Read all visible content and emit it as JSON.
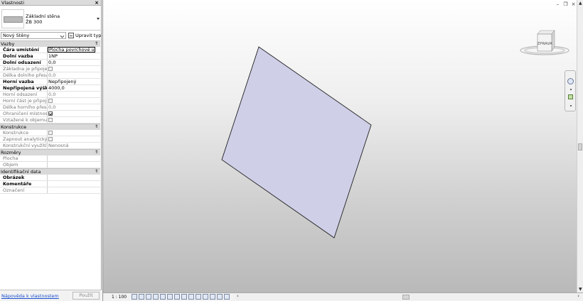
{
  "palette": {
    "title": "Vlastnosti",
    "close": "×",
    "type": {
      "family": "Základní stěna",
      "name": "ŽB 300"
    },
    "filter": {
      "value": "Nový Stěny",
      "edit_type_label": "Upravit typ"
    },
    "groups": [
      {
        "label": "Vazby",
        "rows": [
          {
            "label": "Čára umístění",
            "value": "Plocha povrchové u...",
            "style": "edit"
          },
          {
            "label": "Dolní vazba",
            "value": "1NP",
            "style": "bold"
          },
          {
            "label": "Dolní odsazení",
            "value": "0,0",
            "style": "bold"
          },
          {
            "label": "Základna je připojena.",
            "value": "",
            "style": "dim",
            "checkbox": false
          },
          {
            "label": "Délka dolního přesahu",
            "value": "0,0",
            "style": "dim"
          },
          {
            "label": "Horní vazba",
            "value": "Nepřipojený",
            "style": "bold"
          },
          {
            "label": "Nepřipojená výška",
            "value": "4000,0",
            "style": "bold"
          },
          {
            "label": "Horní odsazení",
            "value": "0,0",
            "style": "dim"
          },
          {
            "label": "Horní část je připojena.",
            "value": "",
            "style": "dim",
            "checkbox": false
          },
          {
            "label": "Délka horního přesahu",
            "value": "0,0",
            "style": "dim"
          },
          {
            "label": "Ohraničení místnosti",
            "value": "",
            "style": "dim",
            "checkbox": true
          },
          {
            "label": "Vztažené k objemu",
            "value": "",
            "style": "dim",
            "checkbox": false
          }
        ]
      },
      {
        "label": "Konstrukce",
        "rows": [
          {
            "label": "Konstrukce",
            "value": "",
            "style": "dim",
            "checkbox": false
          },
          {
            "label": "Zapnout analytický m...",
            "value": "",
            "style": "dim",
            "checkbox": false
          },
          {
            "label": "Konstrukční využití",
            "value": "Nenosná",
            "style": "dim"
          }
        ]
      },
      {
        "label": "Rozměry",
        "rows": [
          {
            "label": "Plocha",
            "value": "",
            "style": "dim"
          },
          {
            "label": "Objem",
            "value": "",
            "style": "dim"
          }
        ]
      },
      {
        "label": "Identifikační data",
        "rows": [
          {
            "label": "Obrázek",
            "value": "",
            "style": "bold"
          },
          {
            "label": "Komentáře",
            "value": "",
            "style": "bold"
          },
          {
            "label": "Označení",
            "value": "",
            "style": "dim"
          }
        ]
      }
    ],
    "group_toggle": "⇑",
    "help_link": "Nápověda k vlastnostem",
    "apply_label": "Použít"
  },
  "view": {
    "viewcube_label": "ZPRAVA",
    "scale": "1 : 100",
    "wall_fill": "#cfcfe8",
    "wall_stroke": "#222222"
  }
}
